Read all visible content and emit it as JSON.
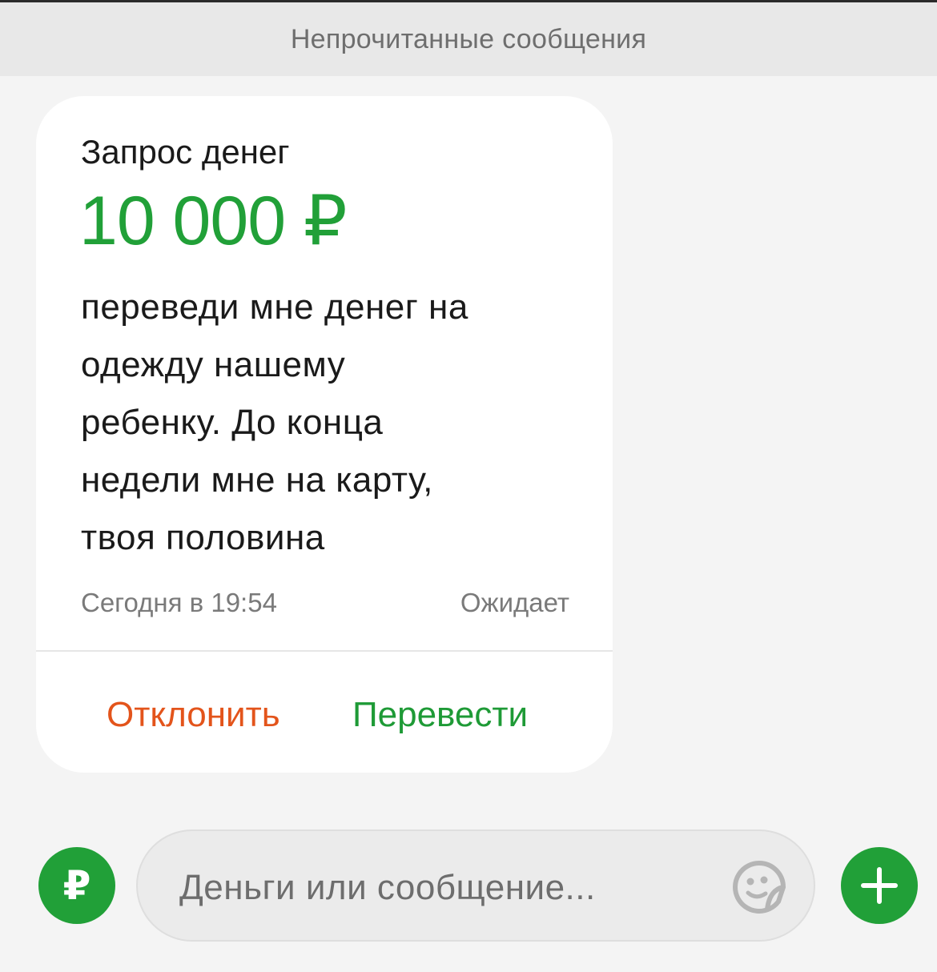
{
  "header": {
    "title": "Непрочитанные сообщения"
  },
  "request_card": {
    "title": "Запрос денег",
    "amount": "10 000 ₽",
    "message_lines": [
      "переведи мне денег на",
      "одежду нашему",
      "ребенку. До конца",
      "недели мне на карту,",
      "твоя половина"
    ],
    "time": "Сегодня в 19:54",
    "status": "Ожидает",
    "decline_label": "Отклонить",
    "transfer_label": "Перевести"
  },
  "composer": {
    "ruble_symbol": "₽",
    "placeholder": "Деньги или сообщение...",
    "sticker_icon": "sticker-icon",
    "plus_icon": "plus-icon"
  },
  "colors": {
    "accent_green": "#21a038",
    "decline_orange": "#e3541b",
    "background": "#f4f4f4"
  }
}
